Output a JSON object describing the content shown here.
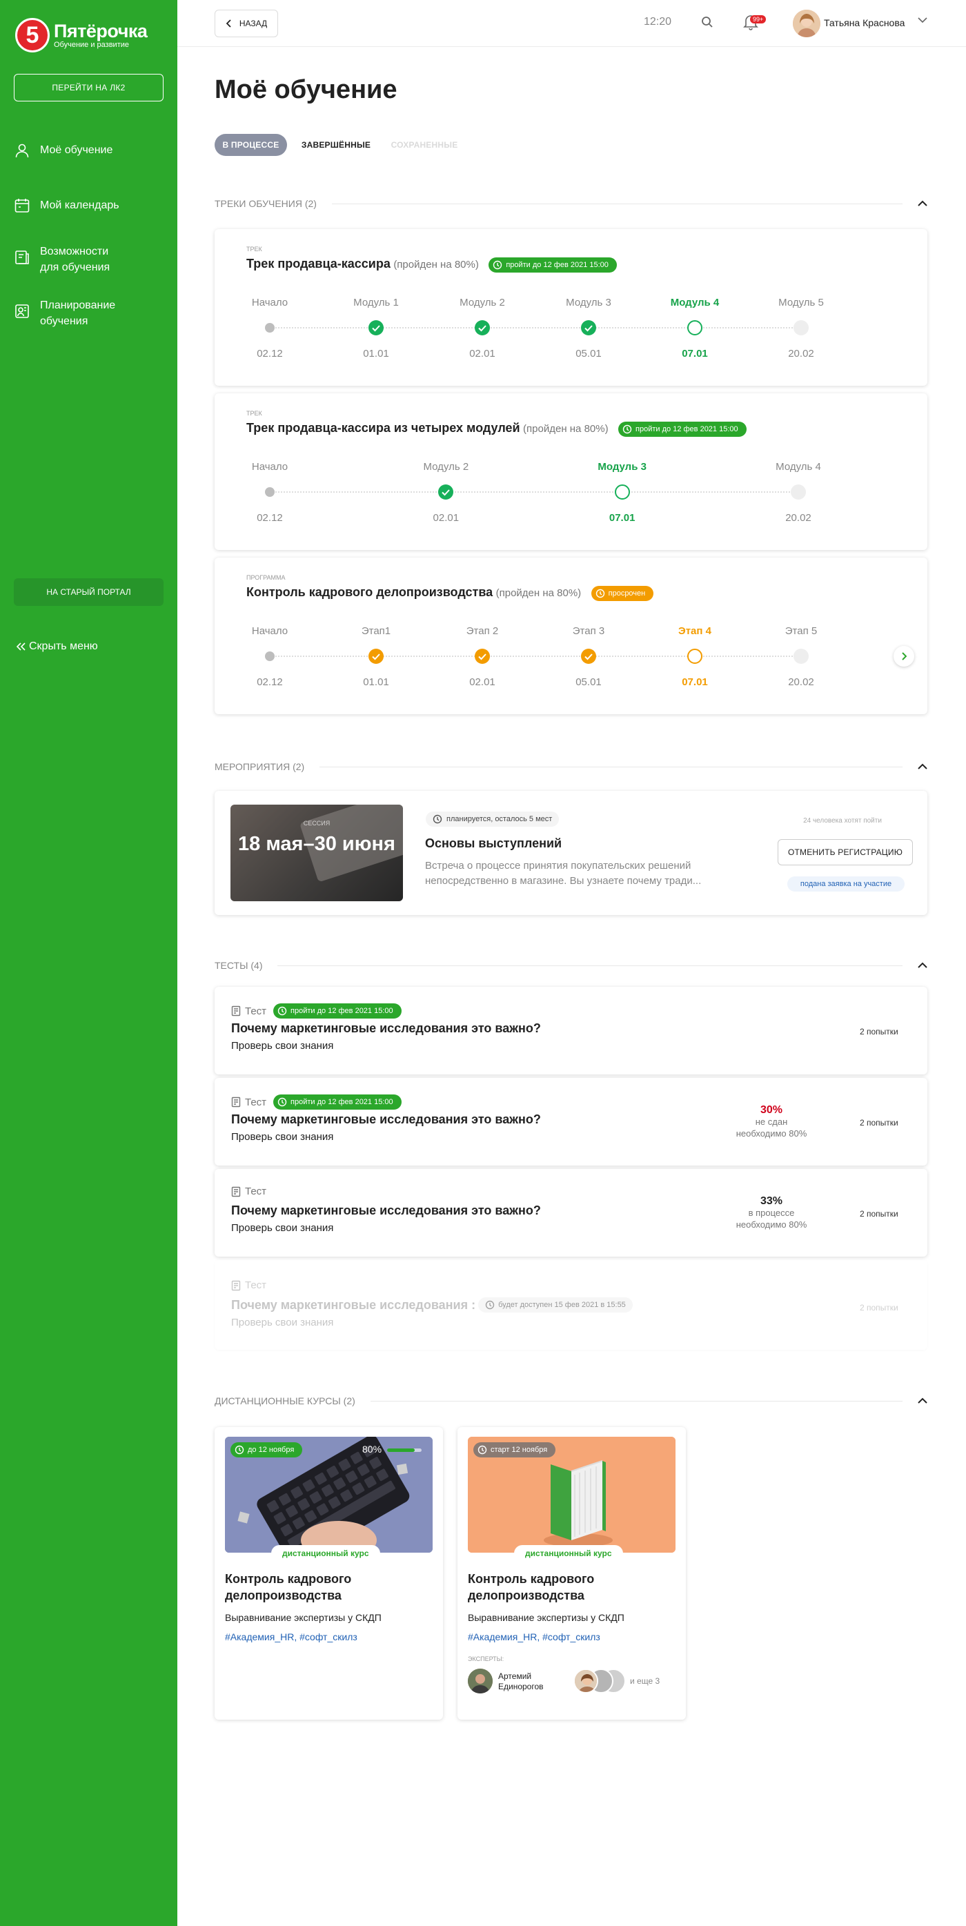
{
  "sidebar": {
    "logo_name": "Пятёрочка",
    "logo_sub": "Обучение и развитие",
    "logo_mark": "5",
    "lk2_button": "ПЕРЕЙТИ НА ЛК2",
    "items": [
      {
        "label": "Моё обучение",
        "icon": "user-icon"
      },
      {
        "label": "Мой календарь",
        "icon": "calendar-icon"
      },
      {
        "label": "Возможности для обучения",
        "icon": "book-icon"
      },
      {
        "label": "Планирование обучения",
        "icon": "planning-icon"
      }
    ],
    "old_portal": "НА СТАРЫЙ ПОРТАЛ",
    "hide_menu": "Скрыть меню"
  },
  "topbar": {
    "back": "НАЗАД",
    "time": "12:20",
    "notif_badge": "99+",
    "user_name": "Татьяна Краснова"
  },
  "page_title": "Моё обучение",
  "tabs": [
    "В ПРОЦЕССЕ",
    "ЗАВЕРШЁННЫЕ",
    "СОХРАНЕННЫЕ"
  ],
  "tracks_section": "ТРЕКИ ОБУЧЕНИЯ (2)",
  "tracks": [
    {
      "kind": "ТРЕК",
      "title": "Трек продавца-кассира",
      "note": "(пройден на 80%)",
      "pill": "пройти до 12 фев 2021 15:00",
      "stages": [
        {
          "label": "Начало",
          "date": "02.12",
          "state": "start"
        },
        {
          "label": "Модуль 1",
          "date": "01.01",
          "state": "done"
        },
        {
          "label": "Модуль 2",
          "date": "02.01",
          "state": "done"
        },
        {
          "label": "Модуль 3",
          "date": "05.01",
          "state": "done"
        },
        {
          "label": "Модуль 4",
          "date": "07.01",
          "state": "current"
        },
        {
          "label": "Модуль 5",
          "date": "20.02",
          "state": "future"
        }
      ]
    },
    {
      "kind": "ТРЕК",
      "title": "Трек продавца-кассира из четырех модулей",
      "note": "(пройден на 80%)",
      "pill": "пройти до 12 фев 2021 15:00",
      "stages": [
        {
          "label": "Начало",
          "date": "02.12",
          "state": "start"
        },
        {
          "label": "Модуль 2",
          "date": "02.01",
          "state": "done"
        },
        {
          "label": "Модуль 3",
          "date": "07.01",
          "state": "current"
        },
        {
          "label": "Модуль 4",
          "date": "20.02",
          "state": "future"
        }
      ]
    },
    {
      "kind": "ПРОГРАММА",
      "title": "Контроль кадрового делопроизводства",
      "note": "(пройден на 80%)",
      "pill": "просрочен",
      "stages": [
        {
          "label": "Начало",
          "date": "02.12",
          "state": "start"
        },
        {
          "label": "Этап1",
          "date": "01.01",
          "state": "done"
        },
        {
          "label": "Этап 2",
          "date": "02.01",
          "state": "done"
        },
        {
          "label": "Этап 3",
          "date": "05.01",
          "state": "done"
        },
        {
          "label": "Этап 4",
          "date": "07.01",
          "state": "current"
        },
        {
          "label": "Этап 5",
          "date": "20.02",
          "state": "future"
        }
      ]
    }
  ],
  "events_section": "МЕРОПРИЯТИЯ (2)",
  "event": {
    "date_header": "СЕССИЯ",
    "date": "18 мая–30 июня",
    "status": "планируется, осталось 5 мест",
    "title": "Основы выступлений",
    "desc": "Встреча о процессе принятия покупательских решений непосредственно в магазине. Вы узнаете почему тради...",
    "want": "24 человека хотят пойти",
    "cancel_button": "ОТМЕНИТЬ РЕГИСТРАЦИЮ",
    "submitted": "подана заявка на участие"
  },
  "tests_section": "ТЕСТЫ (4)",
  "tests": [
    {
      "kind": "Тест",
      "pill": "пройти до 12 фев 2021 15:00",
      "title": "Почему маркетинговые исследования это важно?",
      "sub": "Проверь свои знания",
      "score": "",
      "status": "",
      "req": "",
      "attempts": "2 попытки"
    },
    {
      "kind": "Тест",
      "pill": "пройти до 12 фев 2021 15:00",
      "title": "Почему маркетинговые исследования это важно?",
      "sub": "Проверь свои знания",
      "score": "30%",
      "status": "не сдан",
      "req": "необходимо 80%",
      "attempts": "2 попытки"
    },
    {
      "kind": "Тест",
      "pill": "",
      "title": "Почему маркетинговые исследования это важно?",
      "sub": "Проверь свои знания",
      "score": "33%",
      "status": "в процессе",
      "req": "необходимо 80%",
      "attempts": "2 попытки"
    },
    {
      "kind": "Тест",
      "pill": "будет доступен 15 фев 2021 в 15:55",
      "title": "Почему маркетинговые исследования :",
      "sub": "Проверь свои знания",
      "score": "",
      "status": "",
      "req": "",
      "attempts": "2 попытки"
    }
  ],
  "courses_section": "ДИСТАНЦИОННЫЕ КУРСЫ (2)",
  "courses": [
    {
      "pill": "до 12 ноября",
      "progress": "80%",
      "progress_value": 0.8,
      "tag": "дистанционный курс",
      "title": "Контроль кадрового делопроизводства",
      "sub": "Выравнивание экспертизы у СКДП",
      "hashtags": "#Академия_HR, #софт_скилз"
    },
    {
      "pill": "старт 12 ноября",
      "tag": "дистанционный курс",
      "title": "Контроль кадрового делопроизводства",
      "sub": "Выравнивание экспертизы у СКДП",
      "hashtags": "#Академия_HR, #софт_скилз",
      "experts_label": "ЭКСПЕРТЫ:",
      "expert_name": "Артемий Единорогов",
      "more": "и еще 3"
    }
  ],
  "colors": {
    "green": "#2ba72b",
    "accent_green": "#17a34a",
    "orange": "#f39c00",
    "red": "#d0021b"
  }
}
